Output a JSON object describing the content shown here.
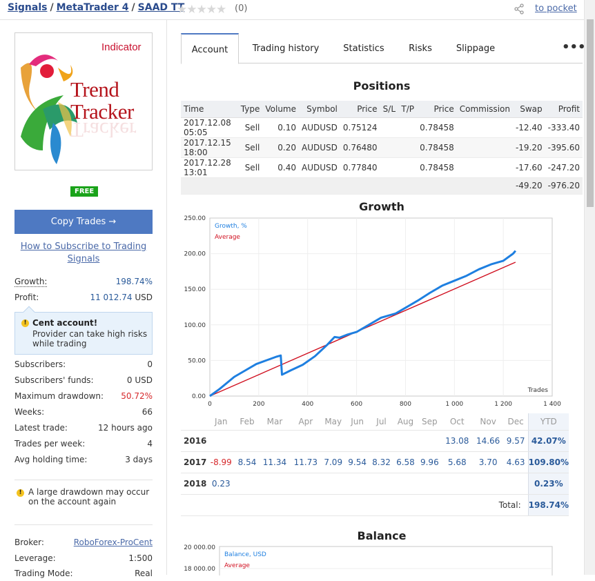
{
  "breadcrumb": {
    "items": [
      "Signals",
      "MetaTrader 4",
      "SAAD TT"
    ],
    "separator": "/"
  },
  "rating": {
    "stars": 0,
    "max_stars": 5,
    "count_label": "(0)"
  },
  "pocket_label": "to pocket",
  "logo": {
    "indicator": "Indicator",
    "line1": "Trend",
    "line2": "Tracker"
  },
  "sidebar": {
    "free_badge": "FREE",
    "copy_button": "Copy Trades →",
    "how_to_link": "How to Subscribe to Trading Signals",
    "growth": {
      "label": "Growth:",
      "value": "198.74%"
    },
    "profit": {
      "label": "Profit:",
      "value": "11 012.74",
      "currency": "USD"
    },
    "cent_notice": {
      "title": "Cent account!",
      "text": "Provider can take high risks while trading"
    },
    "stats": [
      {
        "label": "Subscribers:",
        "value": "0"
      },
      {
        "label": "Subscribers' funds:",
        "value": "0 USD"
      },
      {
        "label": "Maximum drawdown:",
        "value": "50.72%"
      },
      {
        "label": "Weeks:",
        "value": "66"
      },
      {
        "label": "Latest trade:",
        "value": "12 hours ago"
      },
      {
        "label": "Trades per week:",
        "value": "4"
      },
      {
        "label": "Avg holding time:",
        "value": "3 days"
      }
    ],
    "drawdown_warning": "A large drawdown may occur on the account again",
    "broker": {
      "label": "Broker:",
      "value": "RoboForex-ProCent"
    },
    "leverage": {
      "label": "Leverage:",
      "value": "1:500"
    },
    "trading_mode": {
      "label": "Trading Mode:",
      "value": "Real"
    }
  },
  "tabs": [
    "Account",
    "Trading history",
    "Statistics",
    "Risks",
    "Slippage"
  ],
  "more_label": "•••",
  "positions": {
    "title": "Positions",
    "columns": [
      "Time",
      "Type",
      "Volume",
      "Symbol",
      "Price",
      "S/L",
      "T/P",
      "Price",
      "Commission",
      "Swap",
      "Profit"
    ],
    "rows": [
      [
        "2017.12.08 05:05",
        "Sell",
        "0.10",
        "AUDUSD",
        "0.75124",
        "",
        "",
        "0.78458",
        "",
        "-12.40",
        "-333.40"
      ],
      [
        "2017.12.15 18:00",
        "Sell",
        "0.20",
        "AUDUSD",
        "0.76480",
        "",
        "",
        "0.78458",
        "",
        "-19.20",
        "-395.60"
      ],
      [
        "2017.12.28 13:01",
        "Sell",
        "0.40",
        "AUDUSD",
        "0.77840",
        "",
        "",
        "0.78458",
        "",
        "-17.60",
        "-247.20"
      ]
    ],
    "totals": {
      "swap": "-49.20",
      "profit": "-976.20"
    }
  },
  "growth_section": {
    "title": "Growth",
    "months": [
      "Jan",
      "Feb",
      "Mar",
      "Apr",
      "May",
      "Jun",
      "Jul",
      "Aug",
      "Sep",
      "Oct",
      "Nov",
      "Dec"
    ],
    "ytd_label": "YTD",
    "years": [
      {
        "year": "2016",
        "values": [
          "",
          "",
          "",
          "",
          "",
          "",
          "",
          "",
          "",
          "13.08",
          "14.66",
          "9.57"
        ],
        "ytd": "42.07%"
      },
      {
        "year": "2017",
        "values": [
          "-8.99",
          "8.54",
          "11.34",
          "11.73",
          "7.09",
          "9.54",
          "8.32",
          "6.58",
          "9.96",
          "5.68",
          "3.70",
          "4.63"
        ],
        "ytd": "109.80%"
      },
      {
        "year": "2018",
        "values": [
          "0.23",
          "",
          "",
          "",
          "",
          "",
          "",
          "",
          "",
          "",
          "",
          ""
        ],
        "ytd": "0.23%"
      }
    ],
    "total_label": "Total:",
    "total_value": "198.74%"
  },
  "balance_section": {
    "title": "Balance"
  },
  "chart_data": [
    {
      "type": "line",
      "title": "Growth",
      "xlabel": "Trades",
      "ylabel": "",
      "xlim": [
        0,
        1400
      ],
      "ylim": [
        0,
        250
      ],
      "x_ticks": [
        "0",
        "200",
        "400",
        "600",
        "800",
        "1 000",
        "1 200",
        "1 400"
      ],
      "y_ticks": [
        "0.00",
        "50.00",
        "100.00",
        "150.00",
        "200.00",
        "250.00"
      ],
      "legend": "top-left",
      "series": [
        {
          "name": "Growth, %",
          "color": "#1e7fe0",
          "x": [
            0,
            40,
            100,
            140,
            190,
            230,
            270,
            290,
            295,
            330,
            380,
            430,
            480,
            510,
            530,
            560,
            600,
            650,
            700,
            760,
            800,
            850,
            900,
            950,
            1000,
            1050,
            1100,
            1150,
            1200,
            1220,
            1240,
            1250
          ],
          "y": [
            0,
            10,
            27,
            35,
            45,
            50,
            55,
            57,
            30,
            36,
            44,
            56,
            72,
            83,
            82,
            86,
            90,
            100,
            110,
            116,
            124,
            134,
            145,
            155,
            162,
            169,
            178,
            185,
            190,
            195,
            200,
            204
          ]
        },
        {
          "name": "Average",
          "color": "#d01020",
          "x": [
            0,
            1250
          ],
          "y": [
            0,
            188
          ]
        }
      ]
    },
    {
      "type": "line",
      "title": "Balance",
      "y_ticks": [
        "20 000.00",
        "18 000.00"
      ],
      "legend": "top-left",
      "series": [
        {
          "name": "Balance, USD",
          "color": "#1e7fe0"
        },
        {
          "name": "Average",
          "color": "#d01020"
        }
      ]
    }
  ]
}
